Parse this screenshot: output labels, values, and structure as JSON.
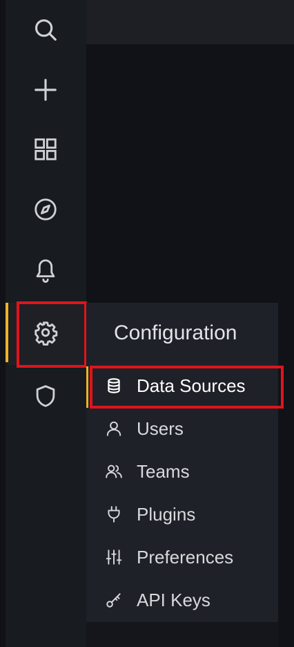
{
  "sidebar": {
    "items": [
      {
        "name": "search",
        "icon": "search-icon"
      },
      {
        "name": "create",
        "icon": "plus-icon"
      },
      {
        "name": "dashboards",
        "icon": "apps-icon"
      },
      {
        "name": "explore",
        "icon": "compass-icon"
      },
      {
        "name": "alerting",
        "icon": "bell-icon"
      },
      {
        "name": "configuration",
        "icon": "gear-icon",
        "active": true
      },
      {
        "name": "server-admin",
        "icon": "shield-icon"
      }
    ]
  },
  "menu": {
    "title": "Configuration",
    "items": [
      {
        "label": "Data Sources",
        "icon": "database-icon",
        "active": true
      },
      {
        "label": "Users",
        "icon": "user-icon"
      },
      {
        "label": "Teams",
        "icon": "users-icon"
      },
      {
        "label": "Plugins",
        "icon": "plug-icon"
      },
      {
        "label": "Preferences",
        "icon": "sliders-icon"
      },
      {
        "label": "API Keys",
        "icon": "key-icon"
      }
    ]
  },
  "colors": {
    "accent": "#f0b424",
    "highlight": "#e0141c",
    "sidebar_bg": "#181b1f",
    "menu_bg": "#1f2128"
  }
}
